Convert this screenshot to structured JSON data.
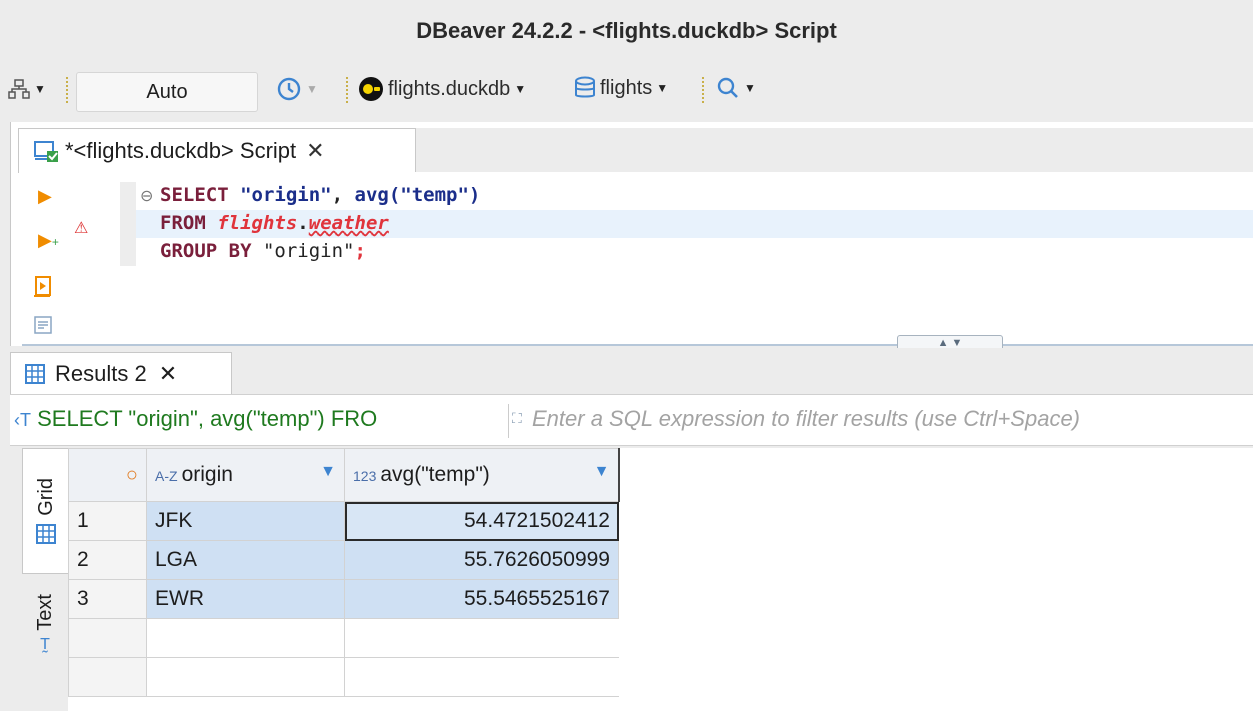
{
  "window": {
    "title": "DBeaver 24.2.2 - <flights.duckdb> Script"
  },
  "toolbar": {
    "transaction_mode": "Auto",
    "datasource": "flights.duckdb",
    "schema": "flights"
  },
  "editor": {
    "tab_label": "*<flights.duckdb> Script",
    "code": {
      "line1": {
        "kw": "SELECT",
        "col1": "\"origin\"",
        "sep": ", ",
        "fn": "avg(\"temp\")"
      },
      "line2": {
        "kw": "FROM",
        "schema": "flights",
        "dot": ".",
        "table": "weather"
      },
      "line3": {
        "kw": "GROUP BY",
        "col": "\"origin\"",
        "semi": ";"
      }
    }
  },
  "results": {
    "tab_label": "Results 2",
    "filter_sql": "SELECT \"origin\", avg(\"temp\") FRO",
    "filter_placeholder": "Enter a SQL expression to filter results (use Ctrl+Space)",
    "side_tabs": {
      "grid": "Grid",
      "text": "Text"
    },
    "columns": [
      {
        "type": "A-Z",
        "name": "origin"
      },
      {
        "type": "123",
        "name": "avg(\"temp\")"
      }
    ],
    "rows": [
      {
        "n": "1",
        "origin": "JFK",
        "avg": "54.4721502412"
      },
      {
        "n": "2",
        "origin": "LGA",
        "avg": "55.7626050999"
      },
      {
        "n": "3",
        "origin": "EWR",
        "avg": "55.5465525167"
      }
    ]
  }
}
